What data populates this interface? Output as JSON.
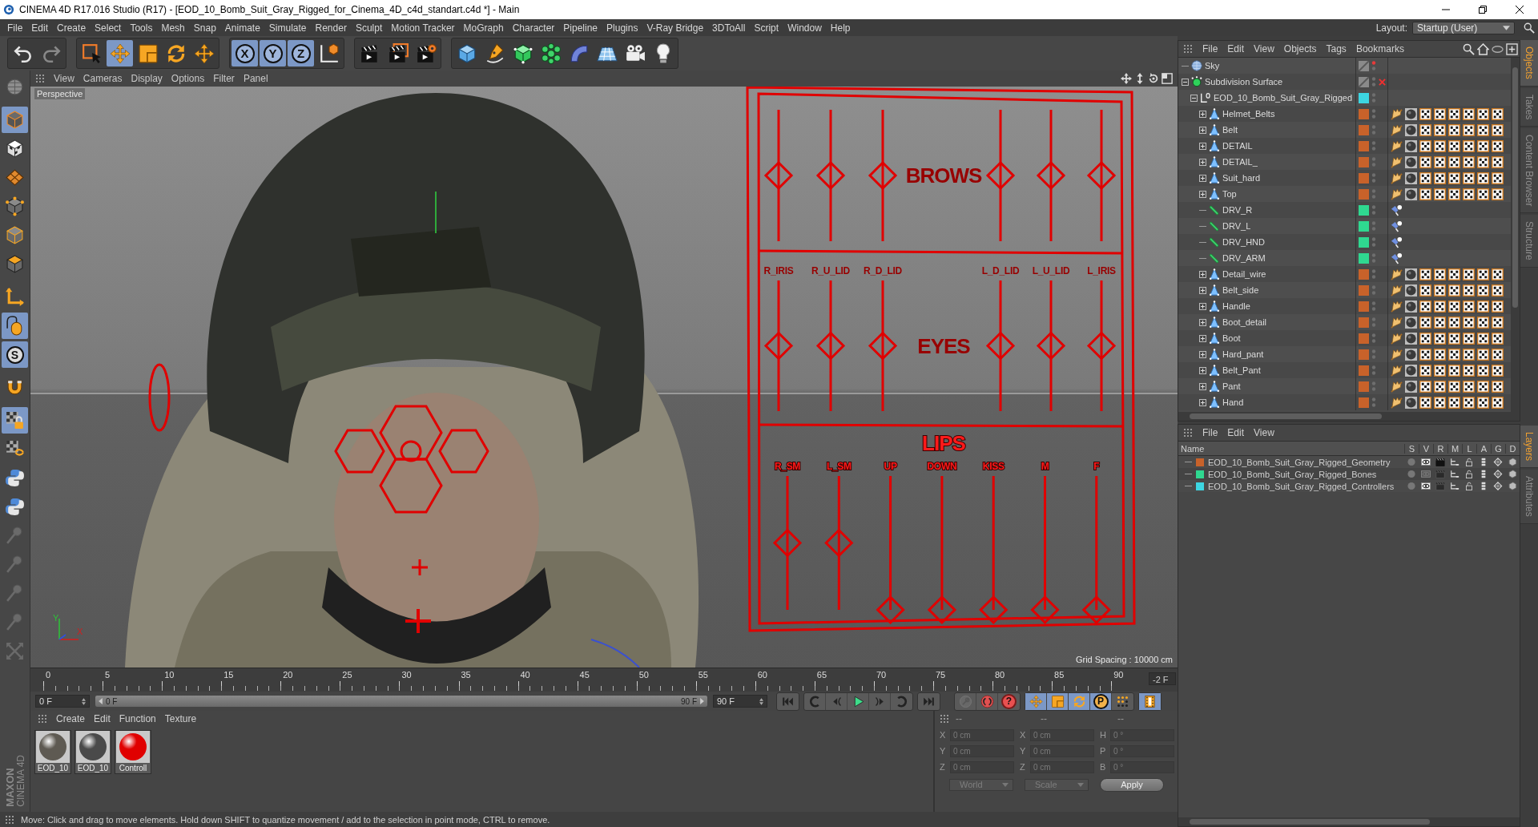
{
  "window": {
    "title": "CINEMA 4D R17.016 Studio (R17) - [EOD_10_Bomb_Suit_Gray_Rigged_for_Cinema_4D_c4d_standart.c4d *] - Main"
  },
  "menu_bar": {
    "items": [
      "File",
      "Edit",
      "Create",
      "Select",
      "Tools",
      "Mesh",
      "Snap",
      "Animate",
      "Simulate",
      "Render",
      "Sculpt",
      "Motion Tracker",
      "MoGraph",
      "Character",
      "Pipeline",
      "Plugins",
      "V-Ray Bridge",
      "3DToAll",
      "Script",
      "Window",
      "Help"
    ],
    "layout_label": "Layout:",
    "layout": "Startup (User)"
  },
  "toolbar": [
    [
      {
        "kind": "undo",
        "selected": false,
        "disabled": false
      },
      {
        "kind": "redo",
        "selected": false,
        "disabled": true
      }
    ],
    [
      {
        "kind": "live-select",
        "selected": false,
        "disabled": false
      },
      {
        "kind": "move",
        "selected": true,
        "disabled": false
      },
      {
        "kind": "scale",
        "selected": false,
        "disabled": false
      },
      {
        "kind": "rotate",
        "selected": false,
        "disabled": false
      },
      {
        "kind": "transform",
        "selected": false,
        "disabled": false
      }
    ],
    [
      {
        "kind": "axis",
        "label": "X",
        "selected": true,
        "disabled": false
      },
      {
        "kind": "axis",
        "label": "Y",
        "selected": true,
        "disabled": false
      },
      {
        "kind": "axis",
        "label": "Z",
        "selected": true,
        "disabled": false
      },
      {
        "kind": "coordinate-system",
        "selected": false,
        "disabled": false
      }
    ],
    [
      {
        "kind": "render-view",
        "selected": false,
        "disabled": false
      },
      {
        "kind": "render-viewer",
        "selected": false,
        "disabled": false
      },
      {
        "kind": "render-settings",
        "selected": false,
        "disabled": false
      }
    ],
    [
      {
        "kind": "cube",
        "selected": false,
        "disabled": false
      },
      {
        "kind": "pen",
        "selected": false,
        "disabled": false
      },
      {
        "kind": "subdivision",
        "selected": false,
        "disabled": false
      },
      {
        "kind": "cloner",
        "selected": false,
        "disabled": false
      },
      {
        "kind": "bend",
        "selected": false,
        "disabled": false
      },
      {
        "kind": "floor",
        "selected": false,
        "disabled": false
      },
      {
        "kind": "camera",
        "selected": false,
        "disabled": false
      },
      {
        "kind": "light",
        "selected": false,
        "disabled": false
      }
    ]
  ],
  "left_toolbar": [
    {
      "kind": "make-editable",
      "selected": false
    },
    {
      "kind": "model",
      "selected": true
    },
    {
      "kind": "texture",
      "selected": false
    },
    {
      "kind": "workplane",
      "selected": false
    },
    {
      "kind": "points",
      "selected": false
    },
    {
      "kind": "edges",
      "selected": false
    },
    {
      "kind": "polygons",
      "selected": false
    },
    {
      "kind": "axis",
      "selected": false
    },
    {
      "kind": "tweak",
      "selected": true
    },
    {
      "kind": "solo",
      "label": "S",
      "selected": true
    },
    {
      "kind": "magnet",
      "selected": false
    },
    {
      "kind": "snap",
      "selected": true
    },
    {
      "kind": "snap-settings",
      "selected": false
    },
    {
      "kind": "python",
      "selected": false
    },
    {
      "kind": "python",
      "selected": false
    },
    {
      "kind": "pin",
      "selected": false
    },
    {
      "kind": "pin",
      "selected": false
    },
    {
      "kind": "pin",
      "selected": false
    },
    {
      "kind": "pin",
      "selected": false
    },
    {
      "kind": "arrows",
      "selected": false
    }
  ],
  "logo": {
    "brand": "MAXON",
    "product": "CINEMA 4D"
  },
  "viewport": {
    "menu": [
      "View",
      "Cameras",
      "Display",
      "Options",
      "Filter",
      "Panel"
    ],
    "camera": "Perspective",
    "grid_spacing": "Grid Spacing : 10000 cm",
    "axis_labels": [
      "Y",
      "X"
    ],
    "rig": {
      "sections": [
        {
          "title": "BROWS",
          "sliders": [
            {
              "level": 0.5
            },
            {
              "level": 0.5
            },
            {
              "level": 0.5
            },
            {
              "level": 0.5
            },
            {
              "level": 0.5
            },
            {
              "level": 0.5
            }
          ]
        },
        {
          "title": "EYES",
          "sliders": [
            {
              "label": "R_IRIS",
              "level": 0.5
            },
            {
              "label": "R_U_LID",
              "level": 0.5
            },
            {
              "label": "R_D_LID",
              "level": 0.5
            },
            {
              "label": "L_D_LID",
              "level": 0.5
            },
            {
              "label": "L_U_LID",
              "level": 0.5
            },
            {
              "label": "L_IRIS",
              "level": 0.5
            }
          ]
        },
        {
          "title": "LIPS",
          "sliders": [
            {
              "label": "R_SM",
              "level": 0.5
            },
            {
              "label": "L_SM",
              "level": 0.5
            },
            {
              "label": "UP",
              "level": 0
            },
            {
              "label": "DOWN",
              "level": 0
            },
            {
              "label": "KISS",
              "level": 0
            },
            {
              "label": "M",
              "level": 0
            },
            {
              "label": "F",
              "level": 0
            }
          ]
        }
      ]
    }
  },
  "timeline": {
    "ticks": [
      "0",
      "5",
      "10",
      "15",
      "20",
      "25",
      "30",
      "35",
      "40",
      "45",
      "50",
      "55",
      "60",
      "65",
      "70",
      "75",
      "80",
      "85",
      "90"
    ],
    "current_frame": "-2 F",
    "start": "0 F",
    "range": {
      "start_label": "0 F",
      "end_label": "90 F",
      "level": 1
    },
    "end": "90 F",
    "playback": [
      [
        {
          "kind": "go-start"
        }
      ],
      [
        {
          "kind": "prev-key"
        },
        {
          "kind": "prev-frame"
        },
        {
          "kind": "play"
        },
        {
          "kind": "next-frame"
        },
        {
          "kind": "next-key"
        }
      ],
      [
        {
          "kind": "go-end"
        }
      ]
    ],
    "keys": [
      [
        {
          "kind": "record",
          "selected": false,
          "disabled": true
        },
        {
          "kind": "autokey",
          "selected": false,
          "disabled": false
        },
        {
          "kind": "keyframe-selection",
          "label": "?",
          "selected": false,
          "disabled": false
        }
      ],
      [
        {
          "kind": "position",
          "selected": true,
          "disabled": false
        },
        {
          "kind": "scale",
          "selected": true,
          "disabled": false
        },
        {
          "kind": "rotation",
          "selected": true,
          "disabled": false
        },
        {
          "kind": "parameter",
          "label": "P",
          "selected": true,
          "disabled": false
        },
        {
          "kind": "point-level",
          "selected": false,
          "disabled": false
        }
      ],
      [
        {
          "kind": "timeline",
          "selected": true,
          "disabled": false
        }
      ]
    ]
  },
  "material_manager": {
    "menu": [
      "Create",
      "Edit",
      "Function",
      "Texture"
    ],
    "materials": [
      {
        "name": "EOD_10",
        "color": "#5e5a52"
      },
      {
        "name": "EOD_10",
        "color": "#4a4a4a"
      },
      {
        "name": "Controll",
        "color": "#e00000"
      }
    ]
  },
  "coordinates": {
    "headers": [
      "--",
      "--",
      "--"
    ],
    "rows": [
      {
        "position_axis": "X",
        "position": "0 cm",
        "size_axis": "X",
        "size": "0 cm",
        "rotation_axis": "H",
        "rotation": "0 °"
      },
      {
        "position_axis": "Y",
        "position": "0 cm",
        "size_axis": "Y",
        "size": "0 cm",
        "rotation_axis": "P",
        "rotation": "0 °"
      },
      {
        "position_axis": "Z",
        "position": "0 cm",
        "size_axis": "Z",
        "size": "0 cm",
        "rotation_axis": "B",
        "rotation": "0 °"
      }
    ],
    "space": "World",
    "mode": "Scale",
    "apply": "Apply"
  },
  "status_bar": {
    "text": "Move: Click and drag to move elements. Hold down SHIFT to quantize movement / add to the selection in point mode, CTRL to remove."
  },
  "object_manager": {
    "menu": [
      "File",
      "Edit",
      "View",
      "Objects",
      "Tags",
      "Bookmarks"
    ],
    "tree": [
      {
        "name": "Sky",
        "kind": "sky",
        "editor_hidden": true,
        "disabled": false
      },
      {
        "name": "Subdivision Surface",
        "kind": "subdivision",
        "editor_hidden": false,
        "disabled": true,
        "expanded": true,
        "children": [
          {
            "name": "EOD_10_Bomb_Suit_Gray_Rigged",
            "kind": "null",
            "color": "#3dd6e2",
            "editor_hidden": false,
            "disabled": false,
            "expanded": true,
            "children": [
              {
                "name": "Helmet_Belts",
                "kind": "polygon",
                "color": "#c8622a",
                "editor_hidden": false,
                "disabled": false,
                "expanded": false
              },
              {
                "name": "Belt",
                "kind": "polygon",
                "color": "#c8622a",
                "editor_hidden": false,
                "disabled": false,
                "expanded": false
              },
              {
                "name": "DETAIL",
                "kind": "polygon",
                "color": "#c8622a",
                "editor_hidden": false,
                "disabled": false,
                "expanded": false
              },
              {
                "name": "DETAIL_",
                "kind": "polygon",
                "color": "#c8622a",
                "editor_hidden": false,
                "disabled": false,
                "expanded": false
              },
              {
                "name": "Suit_hard",
                "kind": "polygon",
                "color": "#c8622a",
                "editor_hidden": false,
                "disabled": false,
                "expanded": false
              },
              {
                "name": "Top",
                "kind": "polygon",
                "color": "#c8622a",
                "editor_hidden": false,
                "disabled": false,
                "expanded": false
              },
              {
                "name": "DRV_R",
                "kind": "joint",
                "color": "#2fd890",
                "editor_hidden": false,
                "disabled": false
              },
              {
                "name": "DRV_L",
                "kind": "joint",
                "color": "#2fd890",
                "editor_hidden": false,
                "disabled": false
              },
              {
                "name": "DRV_HND",
                "kind": "joint",
                "color": "#2fd890",
                "editor_hidden": false,
                "disabled": false
              },
              {
                "name": "DRV_ARM",
                "kind": "joint",
                "color": "#2fd890",
                "editor_hidden": false,
                "disabled": false
              },
              {
                "name": "Detail_wire",
                "kind": "polygon",
                "color": "#c8622a",
                "editor_hidden": false,
                "disabled": false,
                "expanded": false
              },
              {
                "name": "Belt_side",
                "kind": "polygon",
                "color": "#c8622a",
                "editor_hidden": false,
                "disabled": false,
                "expanded": false
              },
              {
                "name": "Handle",
                "kind": "polygon",
                "color": "#c8622a",
                "editor_hidden": false,
                "disabled": false,
                "expanded": false
              },
              {
                "name": "Boot_detail",
                "kind": "polygon",
                "color": "#c8622a",
                "editor_hidden": false,
                "disabled": false,
                "expanded": false
              },
              {
                "name": "Boot",
                "kind": "polygon",
                "color": "#c8622a",
                "editor_hidden": false,
                "disabled": false,
                "expanded": false
              },
              {
                "name": "Hard_pant",
                "kind": "polygon",
                "color": "#c8622a",
                "editor_hidden": false,
                "disabled": false,
                "expanded": false
              },
              {
                "name": "Belt_Pant",
                "kind": "polygon",
                "color": "#c8622a",
                "editor_hidden": false,
                "disabled": false,
                "expanded": false
              },
              {
                "name": "Pant",
                "kind": "polygon",
                "color": "#c8622a",
                "editor_hidden": false,
                "disabled": false,
                "expanded": false
              },
              {
                "name": "Hand",
                "kind": "polygon",
                "color": "#c8622a",
                "editor_hidden": false,
                "disabled": false,
                "expanded": false
              }
            ]
          }
        ]
      }
    ]
  },
  "layer_manager": {
    "menu": [
      "File",
      "Edit",
      "View"
    ],
    "columns": [
      "Name",
      "S",
      "V",
      "R",
      "M",
      "L",
      "A",
      "G",
      "D"
    ],
    "rows": [
      {
        "name": "EOD_10_Bomb_Suit_Gray_Rigged_Geometry",
        "color": "#c8622a",
        "visible": true,
        "render": true
      },
      {
        "name": "EOD_10_Bomb_Suit_Gray_Rigged_Bones",
        "color": "#2fd890",
        "visible": false,
        "render": false
      },
      {
        "name": "EOD_10_Bomb_Suit_Gray_Rigged_Controllers",
        "color": "#3dd6e2",
        "visible": true,
        "render": false
      }
    ]
  },
  "side_tabs": {
    "objects": [
      {
        "label": "Objects",
        "selected": true
      },
      {
        "label": "Takes",
        "selected": false
      },
      {
        "label": "Content Browser",
        "selected": false
      },
      {
        "label": "Structure",
        "selected": false
      }
    ],
    "layers": [
      {
        "label": "Layers",
        "selected": true
      },
      {
        "label": "Attributes",
        "selected": false
      }
    ]
  }
}
